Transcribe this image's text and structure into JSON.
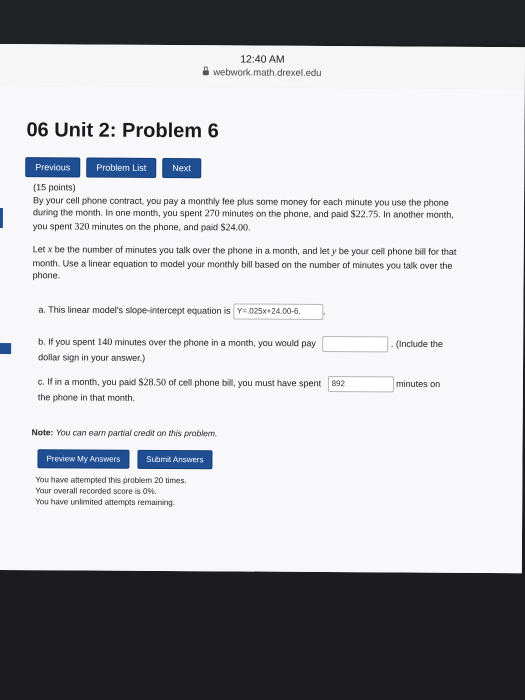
{
  "status": {
    "time": "12:40 AM",
    "url": "webwork.math.drexel.edu"
  },
  "page_title": "06 Unit 2: Problem 6",
  "nav": {
    "previous": "Previous",
    "problem_list": "Problem List",
    "next": "Next"
  },
  "problem": {
    "points": "(15 points)",
    "text1": "By your cell phone contract, you pay a monthly fee plus some money for each minute you use the phone",
    "text2a": "during the month. In one month, you spent ",
    "m1": "270",
    "text2b": " minutes on the phone, and paid ",
    "p1": "$22.75",
    "text2c": ". In another month,",
    "text3a": "you spent ",
    "m2": "320",
    "text3b": " minutes on the phone, and paid ",
    "p2": "$24.00",
    "text3c": ".",
    "para2_a": "Let ",
    "var_x": "x",
    "para2_b": " be the number of minutes you talk over the phone in a month, and let ",
    "var_y": "y",
    "para2_c": " be your cell phone bill for that",
    "para2_line2": "month. Use a linear equation to model your monthly bill based on the number of minutes you talk over the",
    "para2_line3": "phone."
  },
  "parts": {
    "a_label": "a. This linear model's slope-intercept equation is",
    "a_answer": "Y=.025x+24.00-6.",
    "a_suffix": ".",
    "b_label_a": "b. If you spent ",
    "b_value": "140",
    "b_label_b": " minutes over the phone in a month, you would pay",
    "b_answer": "",
    "b_suffix_1": ". (Include the",
    "b_suffix_2": "dollar sign in your answer.)",
    "c_label_a": "c. If in a month, you paid ",
    "c_value": "$28.50",
    "c_label_b": " of cell phone bill, you must have spent",
    "c_answer": "892",
    "c_suffix_1": "minutes on",
    "c_suffix_2": "the phone in that month."
  },
  "note": {
    "label": "Note:",
    "text": "You can earn partial credit on this problem."
  },
  "actions": {
    "preview": "Preview My Answers",
    "submit": "Submit Answers"
  },
  "attempts": {
    "line1": "You have attempted this problem 20 times.",
    "line2": "Your overall recorded score is 0%.",
    "line3": "You have unlimited attempts remaining."
  },
  "colors": {
    "accent": "#1f4e93",
    "page_bg": "#f8f8fa"
  }
}
